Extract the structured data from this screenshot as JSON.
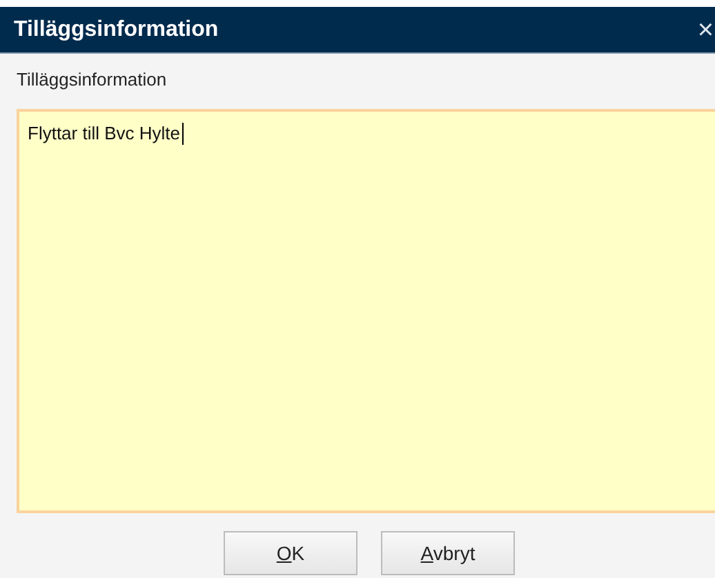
{
  "window": {
    "title": "Tilläggsinformation",
    "close": "×"
  },
  "label": "Tilläggsinformation",
  "text_area": {
    "value": "Flyttar till Bvc Hylte",
    "focused": true
  },
  "buttons": [
    {
      "mnemonic": "O",
      "rest": "K"
    },
    {
      "mnemonic": "A",
      "rest": "vbryt"
    }
  ]
}
